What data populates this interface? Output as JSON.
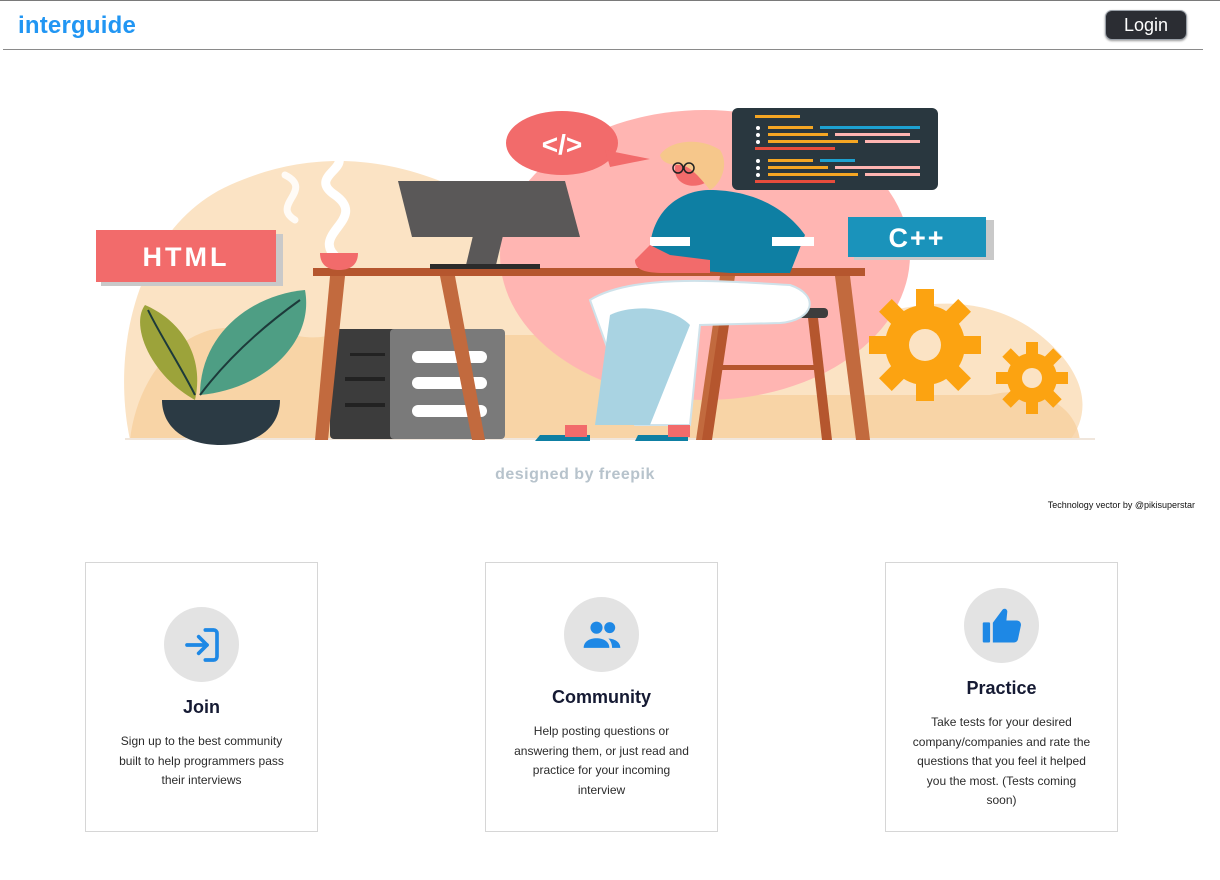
{
  "brand": "interguide",
  "nav": {
    "login_label": "Login"
  },
  "hero": {
    "watermark": "designed by freepik",
    "labels": {
      "html": "HTML",
      "cpp": "C++",
      "code": "</>"
    },
    "credit": "Technology vector by @pikisuperstar"
  },
  "features": [
    {
      "icon": "login-icon",
      "title": "Join",
      "description": "Sign up to the best community built to help programmers pass their interviews"
    },
    {
      "icon": "people-icon",
      "title": "Community",
      "description": "Help posting questions or answering them, or just read and practice for your incoming interview"
    },
    {
      "icon": "thumb-up-icon",
      "title": "Practice",
      "description": "Take tests for your desired company/companies and rate the questions that you feel it helped you the most. (Tests coming soon)"
    }
  ],
  "colors": {
    "brand": "#2196f3",
    "accent_icon": "#1e88e5",
    "button_bg": "#2b2d33"
  }
}
